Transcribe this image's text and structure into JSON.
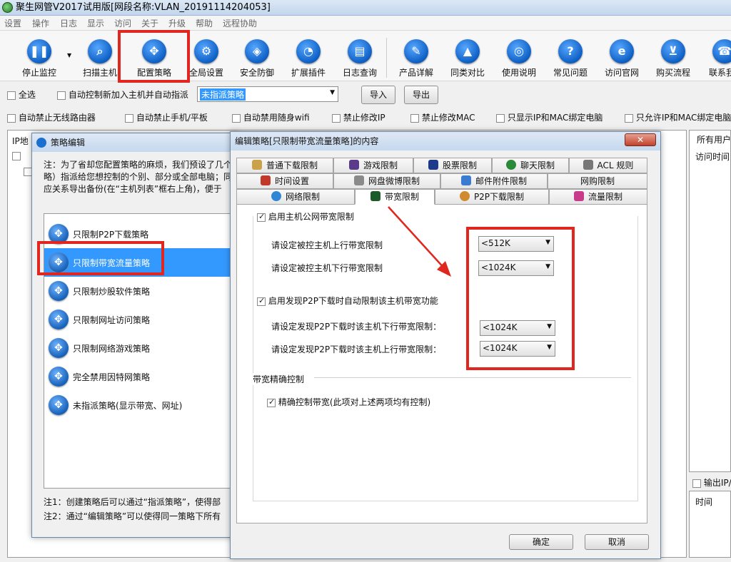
{
  "window": {
    "title": "聚生网管V2017试用版[网段名称:VLAN_20191114204053]"
  },
  "menu": [
    "设置",
    "操作",
    "日志",
    "显示",
    "访问",
    "关于",
    "升级",
    "帮助",
    "远程协助"
  ],
  "toolbar": [
    {
      "label": "停止监控",
      "icon": "pause-icon"
    },
    {
      "label": "扫描主机",
      "icon": "search-icon"
    },
    {
      "label": "配置策略",
      "icon": "move-icon"
    },
    {
      "label": "全局设置",
      "icon": "gear-icon"
    },
    {
      "label": "安全防御",
      "icon": "shield-icon"
    },
    {
      "label": "扩展插件",
      "icon": "plugin-icon"
    },
    {
      "label": "日志查询",
      "icon": "log-icon"
    },
    {
      "label": "产品详解",
      "icon": "edit-icon"
    },
    {
      "label": "同类对比",
      "icon": "cap-icon"
    },
    {
      "label": "使用说明",
      "icon": "guide-icon"
    },
    {
      "label": "常见问题",
      "icon": "question-icon"
    },
    {
      "label": "访问官网",
      "icon": "ie-icon"
    },
    {
      "label": "购买流程",
      "icon": "cart-icon"
    },
    {
      "label": "联系我",
      "icon": "phone-icon"
    }
  ],
  "row1": {
    "select_all": "全选",
    "auto_control": "自动控制新加入主机并自动指派",
    "strategy_value": "未指派策略",
    "import": "导入",
    "export": "导出"
  },
  "row2": [
    "自动禁止无线路由器",
    "自动禁止手机/平板",
    "自动禁用随身wifi",
    "禁止修改IP",
    "禁止修改MAC",
    "只显示IP和MAC绑定电脑",
    "只允许IP和MAC绑定电脑"
  ],
  "left_panel": {
    "header": "IP地"
  },
  "right_panel": {
    "header": "所有用户",
    "col": "访问时间",
    "export_chk": "输出IP/",
    "col2": "时间"
  },
  "strategy_dialog": {
    "title": "策略编辑",
    "note": "注：为了省却您配置策略的麻烦，我们预设了几个\n略）指派给您想控制的个别、部分或全部电脑；同\n应关系导出备份(在“主机列表”框右上角)，便于",
    "items": [
      "只限制P2P下载策略",
      "只限制带宽流量策略",
      "只限制炒股软件策略",
      "只限制网址访问策略",
      "只限制网络游戏策略",
      "完全禁用因特网策略",
      "未指派策略(显示带宽、网址)"
    ],
    "foot1": "注1：创建策略后可以通过“指派策略”，使得部",
    "foot2": "注2：通过“编辑策略”可以使得同一策略下所有"
  },
  "edit_dialog": {
    "title": "编辑策略[只限制带宽流量策略]的内容",
    "tabs_row1": [
      "普通下载限制",
      "游戏限制",
      "股票限制",
      "聊天限制",
      "ACL 规则"
    ],
    "tabs_row2": [
      "时间设置",
      "网盘微博限制",
      "邮件附件限制",
      "网购限制"
    ],
    "tabs_row3": [
      "网络限制",
      "带宽限制",
      "P2P下载限制",
      "流量限制"
    ],
    "enable_public": "启用主机公网带宽限制",
    "upload_label": "请设定被控主机上行带宽限制",
    "upload_value": "<512K",
    "download_label": "请设定被控主机下行带宽限制",
    "download_value": "<1024K",
    "enable_p2p": "启用发现P2P下载时自动限制该主机带宽功能",
    "p2p_down_label": "请设定发现P2P下载时该主机下行带宽限制：",
    "p2p_down_value": "<1024K",
    "p2p_up_label": "请设定发现P2P下载时该主机上行带宽限制：",
    "p2p_up_value": "<1024K",
    "precise_group": "带宽精确控制",
    "precise_chk": "精确控制带宽(此项对上述两项均有控制)",
    "ok": "确定",
    "cancel": "取消"
  },
  "colors": {
    "accent": "#3399ff",
    "highlight_red": "#e0261f"
  }
}
